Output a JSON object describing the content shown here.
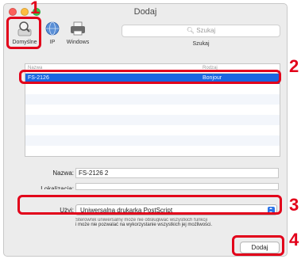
{
  "window": {
    "title": "Dodaj"
  },
  "toolbar": {
    "items": [
      {
        "label": "Domyślne",
        "icon": "magnifier-icon"
      },
      {
        "label": "IP",
        "icon": "globe-icon"
      },
      {
        "label": "Windows",
        "icon": "printer-icon"
      }
    ],
    "search_placeholder": "Szukaj",
    "search_caption": "Szukaj"
  },
  "printer_list": {
    "headers": [
      "Nazwa",
      "Rodzaj"
    ],
    "rows": [
      {
        "name": "FS-2126",
        "kind": "Bonjour",
        "selected": true
      }
    ]
  },
  "form": {
    "name_label": "Nazwa:",
    "name_value": "FS-2126 2",
    "location_label": "Lokalizacja:",
    "location_value": "",
    "use_label": "Użyj:",
    "use_value": "Uniwersalna drukarka PostScript",
    "note_hidden": "Sterownik uniwersalny może nie obsługiwać wszystkich funkcji",
    "note": "i może nie pozwalać na wykorzystanie wszystkich jej możliwości."
  },
  "buttons": {
    "add_label": "Dodaj"
  },
  "callouts": [
    "1",
    "2",
    "3",
    "4"
  ],
  "colors": {
    "callout": "#e2001a",
    "selection": "#1a66e0",
    "stepper": "#2b74e8"
  }
}
